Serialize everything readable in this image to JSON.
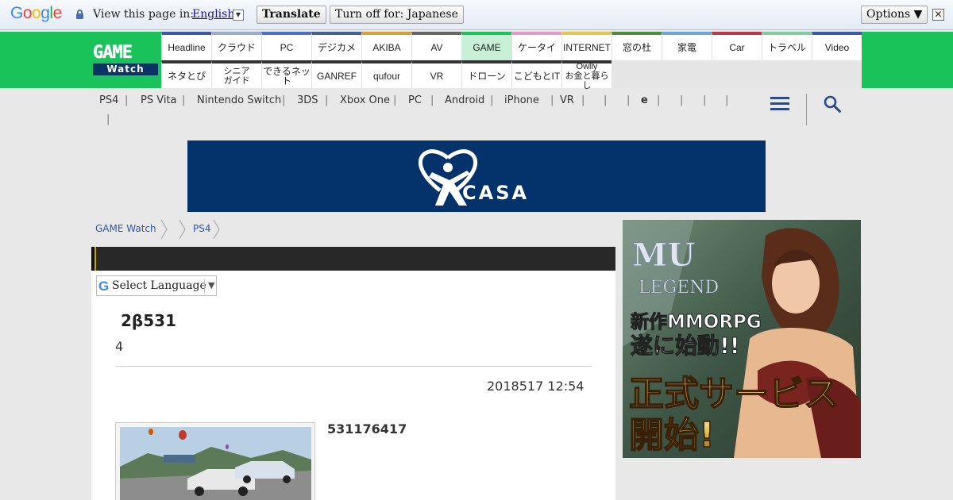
{
  "translate_bar": {
    "logo_letters": [
      "G",
      "o",
      "o",
      "g",
      "l",
      "e"
    ],
    "logo_colors": [
      "#4285f4",
      "#ea4335",
      "#fbbc05",
      "#4285f4",
      "#34a853",
      "#ea4335"
    ],
    "view_label": "View this page in:",
    "language": "English",
    "translate_button": "Translate",
    "turn_off_button": "Turn off for: Japanese",
    "options_button": "Options ▼",
    "close_glyph": "✕"
  },
  "site_logo": {
    "line1": "GAME",
    "line2": "Watch"
  },
  "nav_row1": [
    {
      "label": "Headline",
      "color": "#3d5aa8"
    },
    {
      "label": "クラウド",
      "color": "#9aaed4"
    },
    {
      "label": "PC",
      "color": "#4d6fc9"
    },
    {
      "label": "デジカメ",
      "color": "#43608f"
    },
    {
      "label": "AKIBA",
      "color": "#d6a13d"
    },
    {
      "label": "AV",
      "color": "#666666"
    },
    {
      "label": "GAME",
      "color": "#19c35a"
    },
    {
      "label": "ケータイ",
      "color": "#e39bc7"
    },
    {
      "label": "INTERNET",
      "color": "#e2c84f"
    },
    {
      "label": "窓の杜",
      "color": "#4f8b3c"
    },
    {
      "label": "家電",
      "color": "#6ba8d9"
    },
    {
      "label": "Car",
      "color": "#b83a4a"
    },
    {
      "label": "トラベル",
      "color": "#7fcfa0"
    },
    {
      "label": "Video",
      "color": "#3d5aa8"
    }
  ],
  "nav_row2": [
    {
      "label": "ネタとぴ"
    },
    {
      "label": "シニア\nガイド"
    },
    {
      "label": "できるネット"
    },
    {
      "label": "GANREF"
    },
    {
      "label": "qufour"
    },
    {
      "label": "VR"
    },
    {
      "label": "ドローン"
    },
    {
      "label": "こどもとIT"
    },
    {
      "label": "Owlly\nお金と暮らし"
    }
  ],
  "subnav": [
    "PS4",
    "PS Vita",
    "Nintendo Switch",
    "3DS",
    "Xbox One",
    "PC",
    "Android",
    "iPhone",
    "VR",
    "e"
  ],
  "icons": {
    "menu": "menu-icon",
    "search": "search-icon"
  },
  "banner": {
    "brand": "CASA",
    "reg": "®"
  },
  "breadcrumb": [
    "GAME Watch",
    "PS4"
  ],
  "select_language": {
    "g": "G",
    "label": "Select Language",
    "arrow": "▼"
  },
  "article": {
    "title": "2β531",
    "subtitle": "4",
    "date": "2018517 12:54",
    "caption": "531176417"
  },
  "side_ad": {
    "logo_mu": "MU",
    "logo_legend": "LEGEND",
    "line1": "新作MMORPG",
    "line2": "遂に始動!!",
    "line3": "正式サービス",
    "line4": "開始!"
  }
}
